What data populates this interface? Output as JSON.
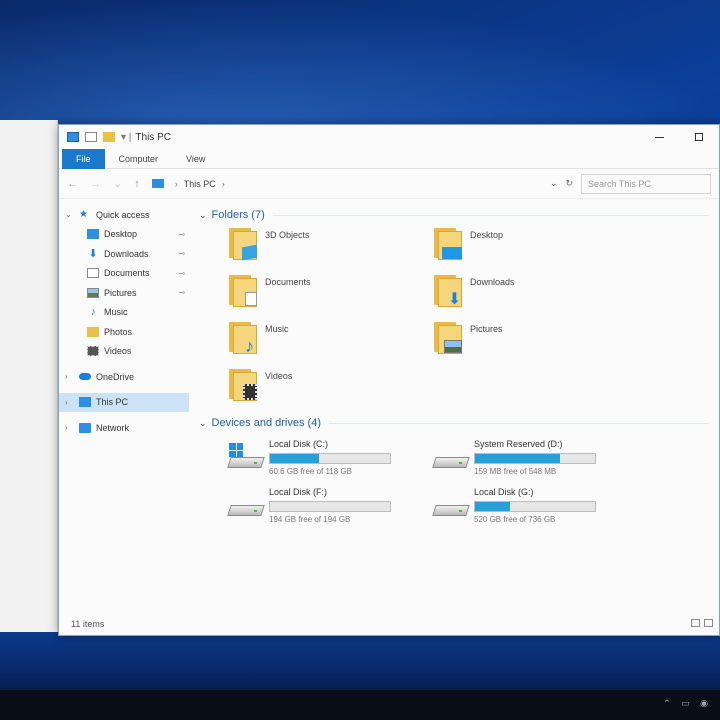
{
  "window": {
    "title": "This PC",
    "minimize_symbol": "—",
    "status_text": "11 items"
  },
  "ribbon": {
    "tabs": [
      {
        "label": "File"
      },
      {
        "label": "Computer"
      },
      {
        "label": "View"
      }
    ]
  },
  "address": {
    "back": "←",
    "forward": "→",
    "recent": "⌄",
    "up": "↑",
    "path": "This PC",
    "path_chevron": "›",
    "dropdown": "⌄",
    "refresh": "↻",
    "search_placeholder": "Search This PC"
  },
  "nav": {
    "quick_access": "Quick access",
    "items": [
      {
        "label": "Desktop",
        "pinned": true
      },
      {
        "label": "Downloads",
        "pinned": true
      },
      {
        "label": "Documents",
        "pinned": true
      },
      {
        "label": "Pictures",
        "pinned": true
      },
      {
        "label": "Music"
      },
      {
        "label": "Photos"
      },
      {
        "label": "Videos"
      }
    ],
    "onedrive": "OneDrive",
    "this_pc": "This PC",
    "network": "Network",
    "pin_symbol": "📌"
  },
  "folders": {
    "header": "Folders (7)",
    "items": [
      {
        "name": "3D Objects",
        "icon": "3d-objects-folder-icon"
      },
      {
        "name": "Desktop",
        "icon": "desktop-folder-icon"
      },
      {
        "name": "Documents",
        "icon": "documents-folder-icon"
      },
      {
        "name": "Downloads",
        "icon": "downloads-folder-icon"
      },
      {
        "name": "Music",
        "icon": "music-folder-icon"
      },
      {
        "name": "Pictures",
        "icon": "pictures-folder-icon"
      },
      {
        "name": "Videos",
        "icon": "videos-folder-icon"
      }
    ]
  },
  "drives": {
    "header": "Devices and drives (4)",
    "items": [
      {
        "name": "Local Disk (C:)",
        "free": "60.6 GB free of 118 GB",
        "used_fraction": 0.41,
        "system": true
      },
      {
        "name": "System Reserved (D:)",
        "free": "159 MB free of 548 MB",
        "used_fraction": 0.71,
        "system": false
      },
      {
        "name": "Local Disk (F:)",
        "free": "194 GB free of 194 GB",
        "used_fraction": 0.0,
        "system": false
      },
      {
        "name": "Local Disk (G:)",
        "free": "520 GB free of 736 GB",
        "used_fraction": 0.29,
        "system": false
      }
    ]
  },
  "colors": {
    "accent": "#1979ca",
    "drive_fill": "#26a0da",
    "selection": "#cce3f7",
    "folder": "#f6d67c"
  }
}
